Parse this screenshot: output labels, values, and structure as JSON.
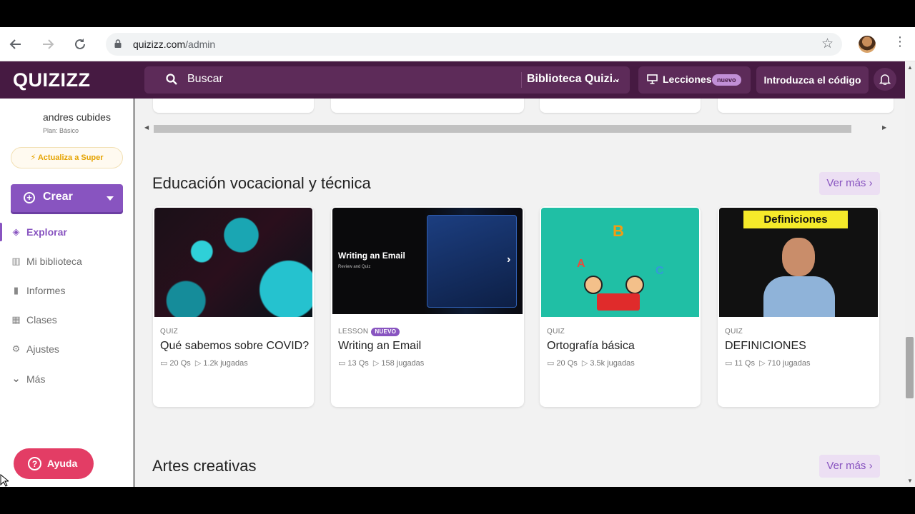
{
  "browser": {
    "url_domain": "quizizz.com",
    "url_path": "/admin",
    "icons": [
      "back-arrow-icon",
      "forward-arrow-icon",
      "reload-icon",
      "lock-icon",
      "star-icon",
      "kebab-menu-icon"
    ]
  },
  "header": {
    "logo": "QUIZIZZ",
    "search_placeholder": "Buscar",
    "library_selector": "Biblioteca Quizi...",
    "lessons_label": "Lecciones",
    "lessons_badge": "nuevo",
    "enter_code_label": "Introduzca el código"
  },
  "sidebar": {
    "user_name": "andres cubides",
    "plan": "Plan: Básico",
    "upgrade_label": "Actualiza a Super",
    "create_label": "Crear",
    "items": [
      {
        "label": "Explorar",
        "icon": "explore-icon",
        "active": true
      },
      {
        "label": "Mi biblioteca",
        "icon": "library-icon",
        "active": false
      },
      {
        "label": "Informes",
        "icon": "reports-icon",
        "active": false
      },
      {
        "label": "Clases",
        "icon": "classes-icon",
        "active": false
      },
      {
        "label": "Ajustes",
        "icon": "gear-icon",
        "active": false
      },
      {
        "label": "Más",
        "icon": "chevron-down-icon",
        "active": false
      }
    ],
    "help_label": "Ayuda"
  },
  "sections": [
    {
      "title": "Educación vocacional y técnica",
      "see_more": "Ver más",
      "cards": [
        {
          "type": "QUIZ",
          "badge": "",
          "title": "Qué sabemos sobre COVID?",
          "questions": "20 Qs",
          "plays": "1.2k jugadas"
        },
        {
          "type": "LESSON",
          "badge": "NUEVO",
          "title": "Writing an Email",
          "questions": "13 Qs",
          "plays": "158 jugadas",
          "thumb_title": "Writing an Email",
          "thumb_subtitle": "Review and Quiz"
        },
        {
          "type": "QUIZ",
          "badge": "",
          "title": "Ortografía básica",
          "questions": "20 Qs",
          "plays": "3.5k jugadas"
        },
        {
          "type": "QUIZ",
          "badge": "",
          "title": "DEFINICIONES",
          "questions": "11 Qs",
          "plays": "710 jugadas",
          "thumb_banner": "Definiciones"
        }
      ]
    },
    {
      "title": "Artes creativas",
      "see_more": "Ver más"
    }
  ],
  "colors": {
    "brand_purple": "#461a42",
    "accent": "#8854c0",
    "help_pink": "#e33d65",
    "upgrade_gold": "#e5a300"
  }
}
